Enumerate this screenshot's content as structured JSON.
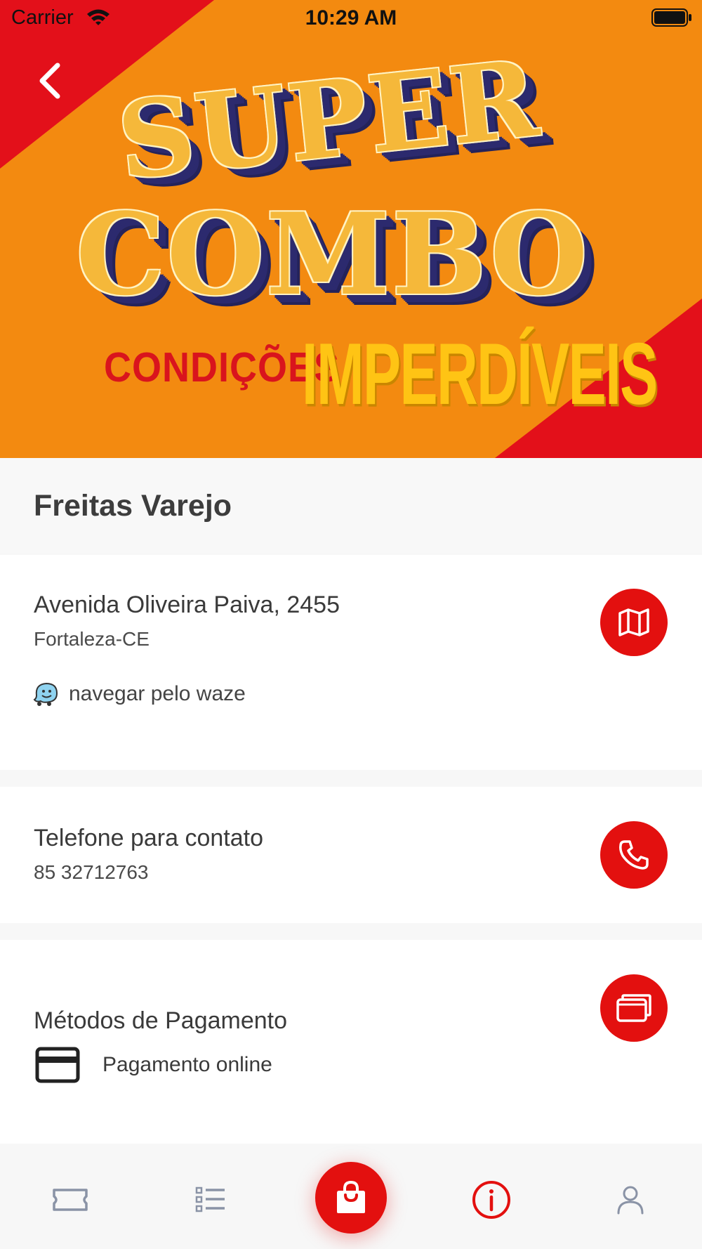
{
  "status_bar": {
    "carrier": "Carrier",
    "time": "10:29 AM"
  },
  "banner": {
    "line1": "SUPER",
    "line2": "COMBO",
    "line3": "CONDIÇÕES",
    "line4": "IMPERDÍVEIS"
  },
  "store": {
    "name": "Freitas Varejo"
  },
  "address": {
    "street": "Avenida Oliveira Paiva, 2455",
    "city": "Fortaleza-CE",
    "waze_label": "navegar pelo waze"
  },
  "phone": {
    "title": "Telefone para contato",
    "number": "85 32712763"
  },
  "payment": {
    "title": "Métodos de Pagamento",
    "method": "Pagamento online"
  },
  "tabs": [
    "coupons",
    "list",
    "cart",
    "info",
    "profile"
  ],
  "colors": {
    "accent": "#e3100f",
    "banner_orange": "#f38a10",
    "banner_red": "#e3101a",
    "tab_icon": "#8a93a6"
  }
}
